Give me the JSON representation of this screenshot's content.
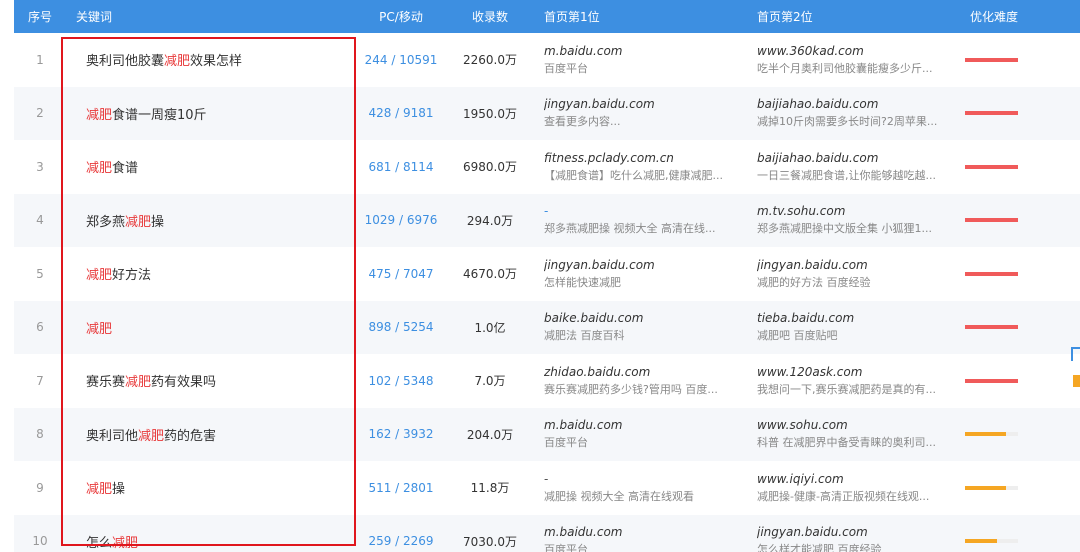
{
  "header": {
    "index": "序号",
    "keyword": "关键词",
    "pc_mobile": "PC/移动",
    "indexed": "收录数",
    "first": "首页第1位",
    "second": "首页第2位",
    "difficulty": "优化难度"
  },
  "colors": {
    "header_bg": "#3d8fe1",
    "highlight": "#e8393a",
    "bar_red": "#f05a5a",
    "bar_orange": "#f5a623",
    "box_border": "#e0161d"
  },
  "rows": [
    {
      "idx": "1",
      "kw": [
        "奥利司他胶囊",
        "减肥",
        "效果怎样"
      ],
      "pc": "244 / 10591",
      "num": "2260.0万",
      "first_site": "m.baidu.com",
      "first_desc": "百度平台",
      "second_site": "www.360kad.com",
      "second_desc": "吃半个月奥利司他胶囊能瘦多少斤...",
      "difficulty": 1.0,
      "difficulty_color": "#f05a5a"
    },
    {
      "idx": "2",
      "kw": [
        "",
        "减肥",
        "食谱一周瘦10斤"
      ],
      "pc": "428 / 9181",
      "num": "1950.0万",
      "first_site": "jingyan.baidu.com",
      "first_desc": "查看更多内容...",
      "second_site": "baijiahao.baidu.com",
      "second_desc": "减掉10斤肉需要多长时间?2周苹果...",
      "difficulty": 1.0,
      "difficulty_color": "#f05a5a"
    },
    {
      "idx": "3",
      "kw": [
        "",
        "减肥",
        "食谱"
      ],
      "pc": "681 / 8114",
      "num": "6980.0万",
      "first_site": "fitness.pclady.com.cn",
      "first_desc": "【减肥食谱】吃什么减肥,健康减肥...",
      "second_site": "baijiahao.baidu.com",
      "second_desc": "一日三餐减肥食谱,让你能够越吃越...",
      "difficulty": 1.0,
      "difficulty_color": "#f05a5a"
    },
    {
      "idx": "4",
      "kw": [
        "郑多燕",
        "减肥",
        "操"
      ],
      "pc": "1029 / 6976",
      "num": "294.0万",
      "first_site": "-",
      "first_desc": "郑多燕减肥操 视频大全 高清在线...",
      "second_site": "m.tv.sohu.com",
      "second_desc": "郑多燕减肥操中文版全集 小狐狸1...",
      "difficulty": 1.0,
      "difficulty_color": "#f05a5a"
    },
    {
      "idx": "5",
      "kw": [
        "",
        "减肥",
        "好方法"
      ],
      "pc": "475 / 7047",
      "num": "4670.0万",
      "first_site": "jingyan.baidu.com",
      "first_desc": "怎样能快速减肥",
      "second_site": "jingyan.baidu.com",
      "second_desc": "减肥的好方法 百度经验",
      "difficulty": 1.0,
      "difficulty_color": "#f05a5a"
    },
    {
      "idx": "6",
      "kw": [
        "",
        "减肥",
        ""
      ],
      "pc": "898 / 5254",
      "num": "1.0亿",
      "first_site": "baike.baidu.com",
      "first_desc": "减肥法 百度百科",
      "second_site": "tieba.baidu.com",
      "second_desc": "减肥吧 百度贴吧",
      "difficulty": 1.0,
      "difficulty_color": "#f05a5a"
    },
    {
      "idx": "7",
      "kw": [
        "赛乐赛",
        "减肥",
        "药有效果吗"
      ],
      "pc": "102 / 5348",
      "num": "7.0万",
      "first_site": "zhidao.baidu.com",
      "first_desc": "赛乐赛减肥药多少钱?管用吗 百度...",
      "second_site": "www.120ask.com",
      "second_desc": "我想问一下,赛乐赛减肥药是真的有...",
      "difficulty": 1.0,
      "difficulty_color": "#f05a5a"
    },
    {
      "idx": "8",
      "kw": [
        "奥利司他",
        "减肥",
        "药的危害"
      ],
      "pc": "162 / 3932",
      "num": "204.0万",
      "first_site": "m.baidu.com",
      "first_desc": "百度平台",
      "second_site": "www.sohu.com",
      "second_desc": "科普 在减肥界中备受青睐的奥利司...",
      "difficulty": 0.78,
      "difficulty_color": "#f5a623"
    },
    {
      "idx": "9",
      "kw": [
        "",
        "减肥",
        "操"
      ],
      "pc": "511 / 2801",
      "num": "11.8万",
      "first_site": "-",
      "first_desc": "减肥操 视频大全 高清在线观看",
      "second_site": "www.iqiyi.com",
      "second_desc": "减肥操-健康-高清正版视频在线观...",
      "difficulty": 0.78,
      "difficulty_color": "#f5a623"
    },
    {
      "idx": "10",
      "kw": [
        "怎么",
        "减肥",
        ""
      ],
      "pc": "259 / 2269",
      "num": "7030.0万",
      "first_site": "m.baidu.com",
      "first_desc": "百度平台",
      "second_site": "jingyan.baidu.com",
      "second_desc": "怎么样才能减肥 百度经验",
      "difficulty": 0.6,
      "difficulty_color": "#f5a623"
    }
  ]
}
